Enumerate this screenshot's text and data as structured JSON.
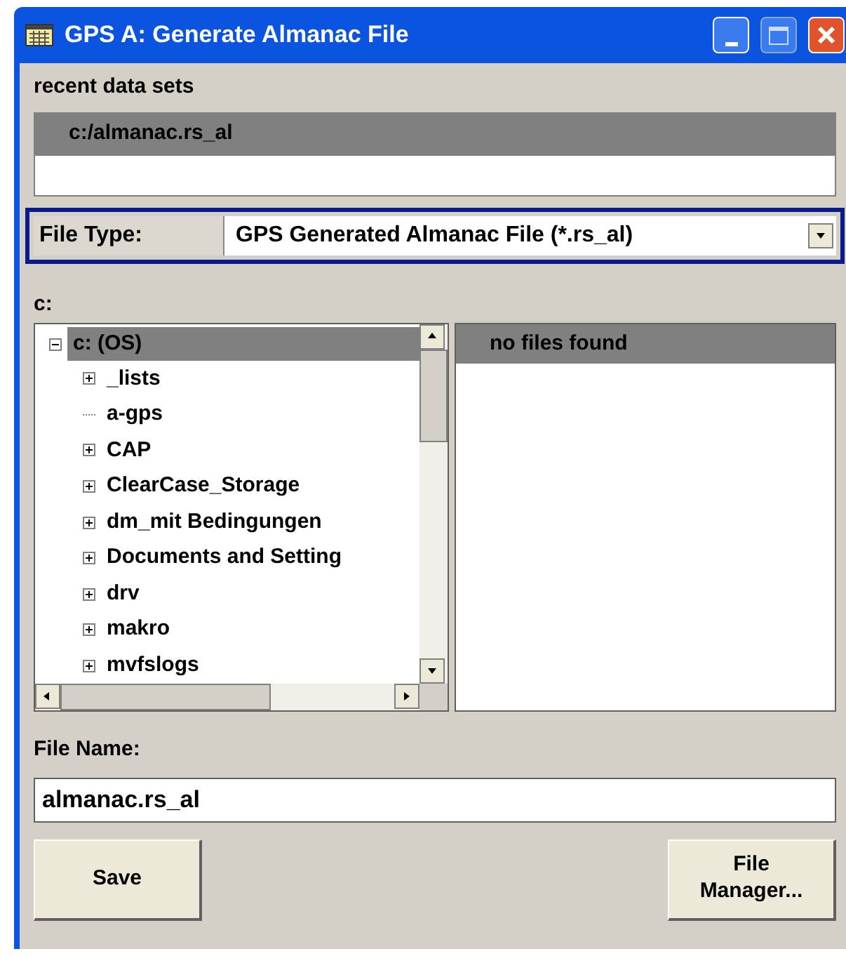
{
  "window": {
    "title": "GPS A: Generate Almanac File"
  },
  "recent": {
    "label": "recent data sets",
    "items": [
      {
        "text": "c:/almanac.rs_al",
        "selected": true
      }
    ]
  },
  "file_type": {
    "label": "File Type:",
    "value": "GPS Generated Almanac File (*.rs_al)"
  },
  "drive_label": "c:",
  "tree": [
    {
      "label": "c: (OS)",
      "selected": true,
      "expanded": true,
      "children": [
        {
          "label": "_lists",
          "selected": false,
          "expandable": true
        },
        {
          "label": "a-gps",
          "selected": false,
          "expandable": false
        },
        {
          "label": "CAP",
          "selected": false,
          "expandable": true
        },
        {
          "label": "ClearCase_Storage",
          "selected": false,
          "expandable": true
        },
        {
          "label": "dm_mit Bedingungen",
          "selected": false,
          "expandable": true
        },
        {
          "label": "Documents and Setting",
          "selected": false,
          "expandable": true
        },
        {
          "label": "drv",
          "selected": false,
          "expandable": true
        },
        {
          "label": "makro",
          "selected": false,
          "expandable": true
        },
        {
          "label": "mvfslogs",
          "selected": false,
          "expandable": true
        }
      ]
    }
  ],
  "files": {
    "message": "no files found"
  },
  "file_name": {
    "label": "File Name:",
    "value": "almanac.rs_al"
  },
  "buttons": [
    {
      "label": "Save"
    },
    {
      "label": "File Manager..."
    }
  ]
}
